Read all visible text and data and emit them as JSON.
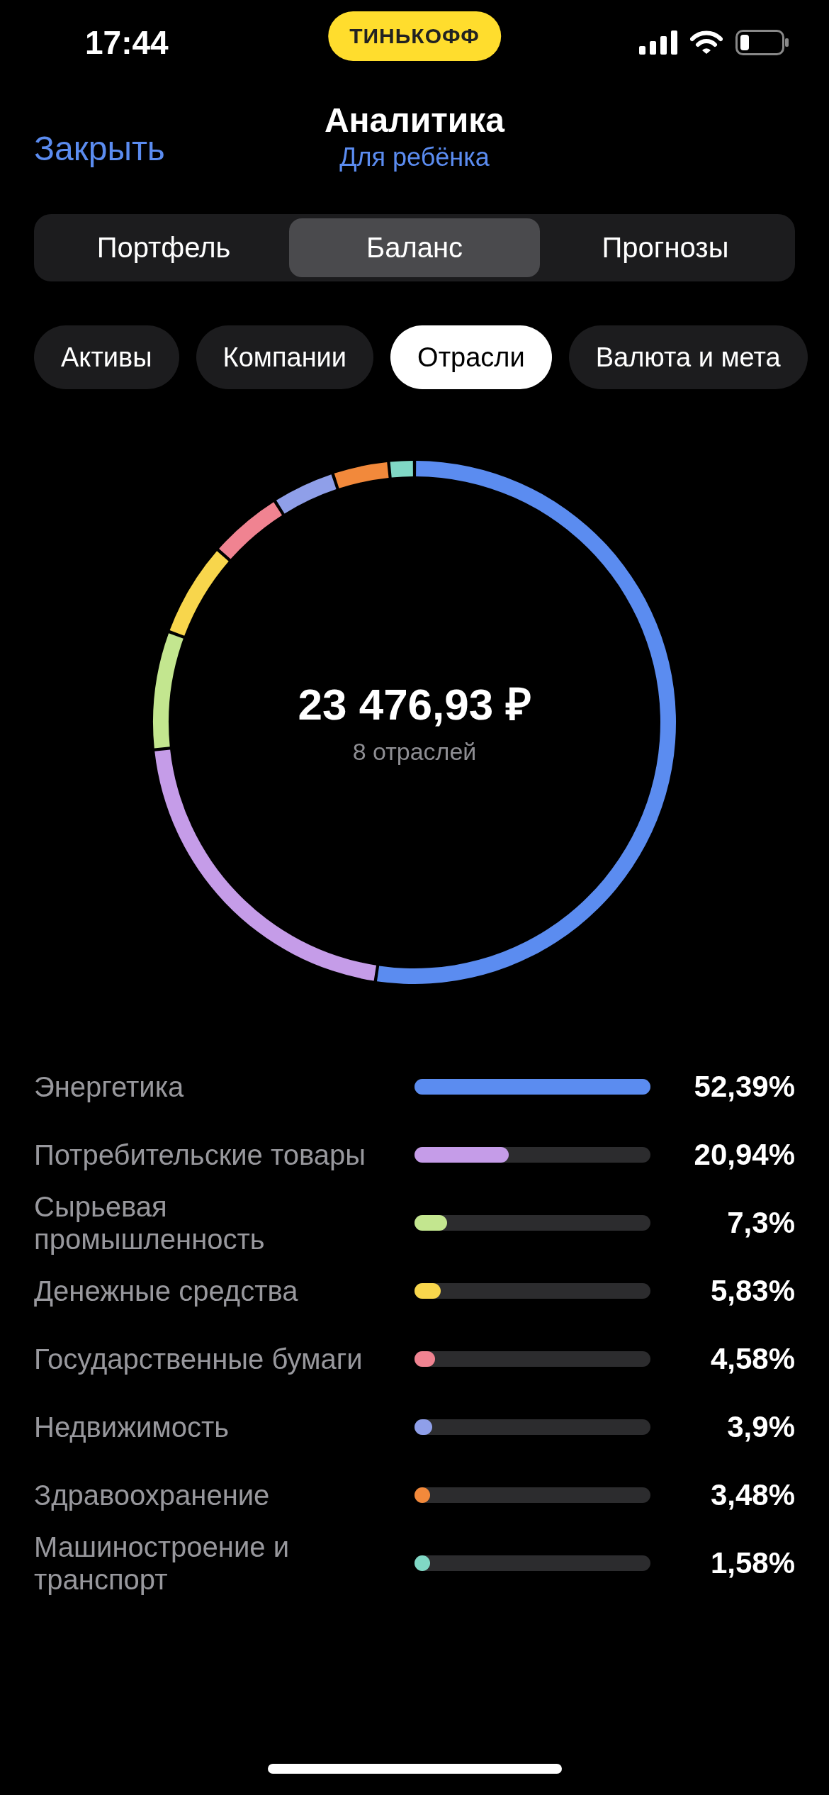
{
  "status_bar": {
    "time": "17:44",
    "brand": "ТИНЬКОФФ"
  },
  "header": {
    "close": "Закрыть",
    "title": "Аналитика",
    "subtitle": "Для ребёнка"
  },
  "segments": [
    {
      "label": "Портфель",
      "selected": false
    },
    {
      "label": "Баланс",
      "selected": true
    },
    {
      "label": "Прогнозы",
      "selected": false
    }
  ],
  "chips": [
    {
      "label": "Активы",
      "selected": false
    },
    {
      "label": "Компании",
      "selected": false
    },
    {
      "label": "Отрасли",
      "selected": true
    },
    {
      "label": "Валюта и мета",
      "selected": false
    }
  ],
  "donut": {
    "total": "23 476,93 ₽",
    "caption": "8 отраслей",
    "chart_data": {
      "type": "donut",
      "values": [
        52.39,
        20.94,
        7.3,
        5.83,
        4.58,
        3.9,
        3.48,
        1.58
      ]
    }
  },
  "legend": [
    {
      "label": "Энергетика",
      "value": "52,39%",
      "level": 1,
      "color": "#5b8cf0"
    },
    {
      "label": "Потребительские товары",
      "value": "20,94%",
      "level": 0.4,
      "color": "#c59ce8"
    },
    {
      "label": "Сырьевая промышленность",
      "value": "7,3%",
      "level": 0.139,
      "color": "#c3e68f"
    },
    {
      "label": "Денежные средства",
      "value": "5,83%",
      "level": 0.111,
      "color": "#f8d64c"
    },
    {
      "label": "Государственные бумаги",
      "value": "4,58%",
      "level": 0.087,
      "color": "#f08391"
    },
    {
      "label": "Недвижимость",
      "value": "3,9%",
      "level": 0.074,
      "color": "#8f9fe9"
    },
    {
      "label": "Здравоохранение",
      "value": "3,48%",
      "level": 0.066,
      "color": "#f2893b"
    },
    {
      "label": "Машиностроение и транспорт",
      "value": "1,58%",
      "level": 0.03,
      "color": "#80d8c5"
    }
  ]
}
